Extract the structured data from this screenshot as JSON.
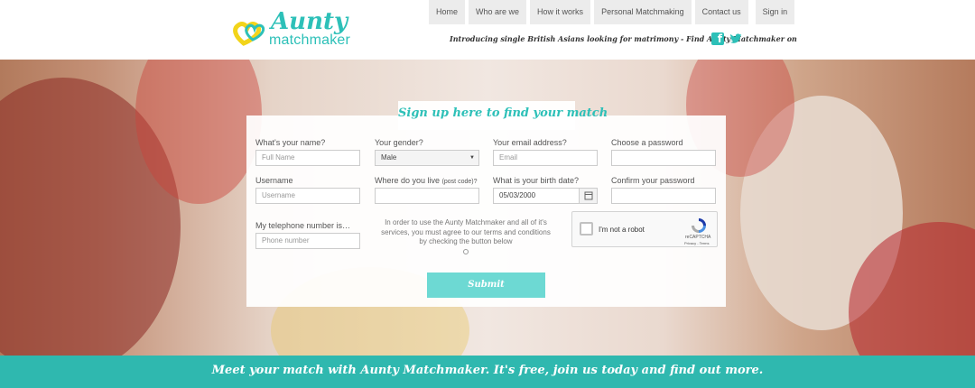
{
  "brand": {
    "logo_word1": "Aunty",
    "logo_word2": "matchmaker",
    "accent_color": "#2dc0b8",
    "heart_colors": [
      "#f2d41a",
      "#2dc0b8"
    ]
  },
  "nav": {
    "items": [
      "Home",
      "Who are we",
      "How it works",
      "Personal Matchmaking",
      "Contact us"
    ],
    "signin": "Sign in"
  },
  "tagline": "Introducing single British Asians looking for matrimony - Find Aunty Matchmaker on",
  "social": {
    "facebook_icon": "facebook-icon",
    "twitter_icon": "twitter-icon"
  },
  "form": {
    "title": "Sign up here to find your match",
    "name": {
      "label": "What's your name?",
      "placeholder": "Full Name"
    },
    "gender": {
      "label": "Your gender?",
      "value": "Male"
    },
    "email": {
      "label": "Your email address?",
      "placeholder": "Email"
    },
    "password": {
      "label": "Choose a password",
      "placeholder": ""
    },
    "username": {
      "label": "Username",
      "placeholder": "Username"
    },
    "location": {
      "label": "Where do you live",
      "label_note": "(post code)?",
      "placeholder": ""
    },
    "birthdate": {
      "label": "What is your birth date?",
      "value": "05/03/2000"
    },
    "confirm": {
      "label": "Confirm your password",
      "placeholder": ""
    },
    "phone": {
      "label": "My telephone number is…",
      "placeholder": "Phone number"
    },
    "terms": "In order to use the Aunty Matchmaker and all of it's services, you must agree to our terms and conditions by checking the button below",
    "captcha": {
      "text": "I'm not a robot",
      "brand": "reCAPTCHA",
      "links": "Privacy - Terms"
    },
    "submit": "Submit"
  },
  "banner": {
    "text": "Meet your match with Aunty Matchmaker. It's free, join us today and find out more."
  }
}
